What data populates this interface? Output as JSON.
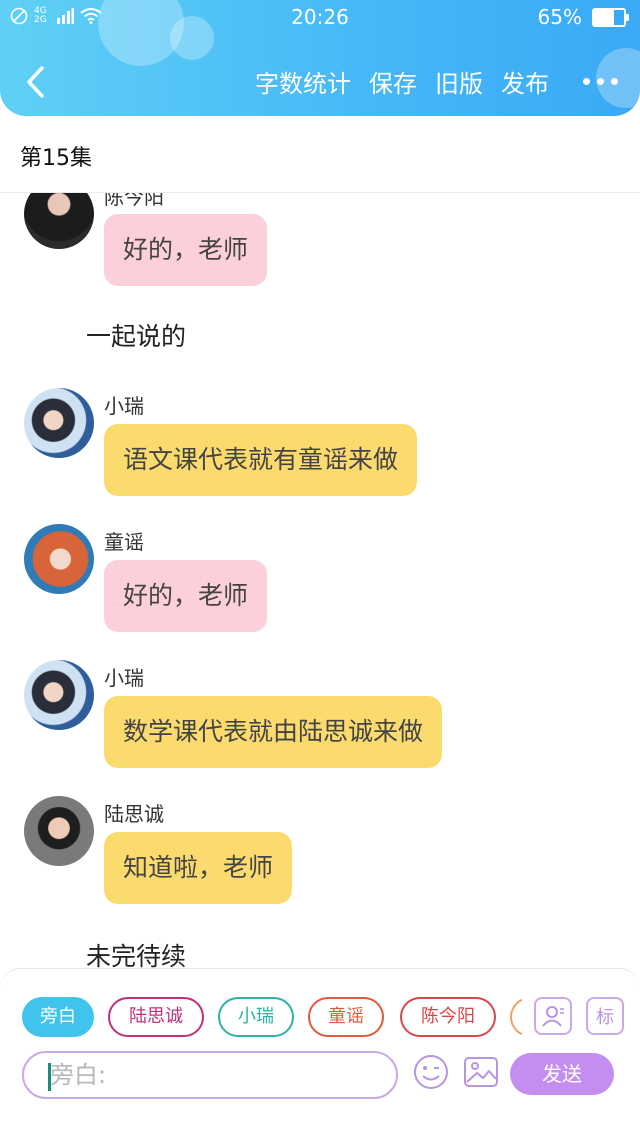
{
  "status_bar": {
    "network": "4G 2G",
    "time": "20:26",
    "battery": "65%",
    "battery_level": 0.65
  },
  "toolbar": {
    "back_icon": "chevron-left-icon",
    "actions": [
      "字数统计",
      "保存",
      "旧版",
      "发布"
    ],
    "more_icon": "more-dots-icon"
  },
  "episode": {
    "title": "第15集"
  },
  "messages": [
    {
      "sender": "陈今阳",
      "text": "好的，老师",
      "bubble": "pink"
    },
    {
      "narration": "一起说的"
    },
    {
      "sender": "小瑞",
      "text": "语文课代表就有童谣来做",
      "bubble": "yellow"
    },
    {
      "sender": "童谣",
      "text": "好的，老师",
      "bubble": "pink"
    },
    {
      "sender": "小瑞",
      "text": "数学课代表就由陆思诚来做",
      "bubble": "yellow"
    },
    {
      "sender": "陆思诚",
      "text": "知道啦，老师",
      "bubble": "yellow"
    },
    {
      "narration": "未完待续"
    }
  ],
  "composer": {
    "roles": [
      {
        "label": "旁白",
        "color": "#40c4ee",
        "active": true
      },
      {
        "label": "陆思诚",
        "color": "#c0307a",
        "active": false
      },
      {
        "label": "小瑞",
        "color": "#2bb3a6",
        "active": false
      },
      {
        "label": "童谣",
        "color": "#e05a3c",
        "active": false
      },
      {
        "label": "陈今阳",
        "color": "#d84848",
        "active": false
      }
    ],
    "role_manage_icon": "user-profile-icon",
    "tag_label": "标",
    "input_placeholder": "旁白:",
    "emoji_icon": "smile-icon",
    "image_icon": "image-icon",
    "send_label": "发送"
  }
}
